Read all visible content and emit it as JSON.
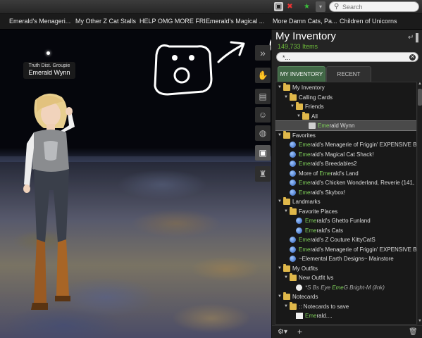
{
  "topbar": {
    "search_placeholder": "Search",
    "icons": [
      "media-disabled-icon",
      "voice-disabled-icon",
      "favorite-star-icon"
    ]
  },
  "favorites": [
    "Emerald's Menageri...",
    "My Other Z Cat Stalls",
    "HELP OMG MORE FRI...",
    "Emerald's Magical ...",
    "More Damn Cats, Pa...",
    "Children of Unicorns"
  ],
  "world": {
    "nametag_group": "Truth Dist. Groupie",
    "nametag_name": "Emerald Wynn"
  },
  "panel": {
    "title": "My Inventory",
    "item_count": "149,733 Items",
    "filter_value": "*...",
    "tabs": [
      "MY INVENTORY",
      "RECENT"
    ]
  },
  "tree": [
    {
      "label": "My Inventory",
      "type": "folder",
      "depth": 0
    },
    {
      "label": "Calling Cards",
      "type": "folder",
      "depth": 1
    },
    {
      "label": "Friends",
      "type": "folder",
      "depth": 2
    },
    {
      "label": "All",
      "type": "folder",
      "depth": 3
    },
    {
      "label": "Emerald Wynn",
      "type": "card",
      "depth": 4,
      "selected": true
    },
    {
      "label": "Favorites",
      "type": "folder",
      "depth": 0
    },
    {
      "label": "Emerald's Menagerie of Friggin' EXPENSIVE Bre",
      "type": "lm",
      "depth": 1
    },
    {
      "label": "Emerald's Magical Cat Shack!",
      "type": "lm",
      "depth": 1
    },
    {
      "label": "Emerald's Breedables2",
      "type": "lm",
      "depth": 1
    },
    {
      "label": "More of Emerald's Land",
      "type": "lm",
      "depth": 1
    },
    {
      "label": "Emerald's Chicken Wonderland, Reverie (141,",
      "type": "lm",
      "depth": 1
    },
    {
      "label": "Emerald's Skybox!",
      "type": "lm",
      "depth": 1
    },
    {
      "label": "Landmarks",
      "type": "folder",
      "depth": 0
    },
    {
      "label": "Favorite Places",
      "type": "folder",
      "depth": 1
    },
    {
      "label": "Emerald's Ghetto Funland",
      "type": "lm",
      "depth": 2
    },
    {
      "label": "Emerald's Cats",
      "type": "lm",
      "depth": 2
    },
    {
      "label": "Emerald's Z Couture KittyCatS",
      "type": "lm",
      "depth": 1
    },
    {
      "label": "Emerald's Menagerie of Friggin' EXPENSIVE Bre",
      "type": "lm",
      "depth": 1
    },
    {
      "label": "~Elemental Earth Designs~ Mainstore",
      "type": "lm",
      "depth": 1
    },
    {
      "label": "My Outfits",
      "type": "folder",
      "depth": 0
    },
    {
      "label": "New Outfit lvs",
      "type": "folder",
      "depth": 1
    },
    {
      "label": "*S Bs Eye EmeG Bright-M (link)",
      "type": "eye",
      "depth": 2,
      "dim": true
    },
    {
      "label": "Notecards",
      "type": "folder",
      "depth": 0
    },
    {
      "label": ":: Notecards to save",
      "type": "folder",
      "depth": 1
    },
    {
      "label": "Emerald....",
      "type": "note",
      "depth": 2
    }
  ],
  "bottom": {
    "gear_label": "⚙▾",
    "add_label": "+",
    "trash_label": "🗑"
  }
}
